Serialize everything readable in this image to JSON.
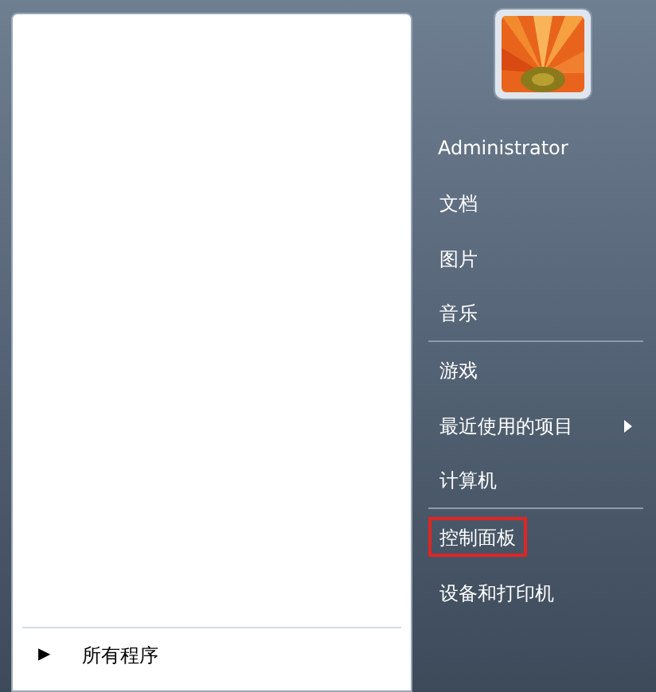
{
  "all_programs": {
    "arrow": "▶",
    "label": "所有程序"
  },
  "user": {
    "name": "Administrator"
  },
  "right_items": [
    {
      "label": "文档",
      "highlighted": false,
      "divider_after": false,
      "submenu": false
    },
    {
      "label": "图片",
      "highlighted": false,
      "divider_after": false,
      "submenu": false
    },
    {
      "label": "音乐",
      "highlighted": false,
      "divider_after": true,
      "submenu": false
    },
    {
      "label": "游戏",
      "highlighted": false,
      "divider_after": false,
      "submenu": false
    },
    {
      "label": "最近使用的项目",
      "highlighted": false,
      "divider_after": false,
      "submenu": true
    },
    {
      "label": "计算机",
      "highlighted": false,
      "divider_after": true,
      "submenu": false
    },
    {
      "label": "控制面板",
      "highlighted": true,
      "divider_after": false,
      "submenu": false
    },
    {
      "label": "设备和打印机",
      "highlighted": false,
      "divider_after": false,
      "submenu": false
    }
  ]
}
